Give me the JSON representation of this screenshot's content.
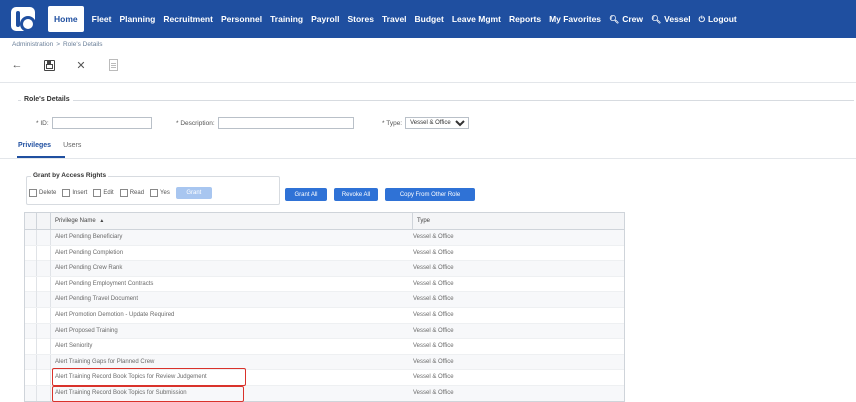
{
  "nav": {
    "items": [
      {
        "label": "Home",
        "active": true
      },
      {
        "label": "Fleet"
      },
      {
        "label": "Planning"
      },
      {
        "label": "Recruitment"
      },
      {
        "label": "Personnel"
      },
      {
        "label": "Training"
      },
      {
        "label": "Payroll"
      },
      {
        "label": "Stores"
      },
      {
        "label": "Travel"
      },
      {
        "label": "Budget"
      },
      {
        "label": "Leave Mgmt"
      },
      {
        "label": "Reports"
      },
      {
        "label": "My Favorites"
      },
      {
        "label": "Crew",
        "icon": "search-icon"
      },
      {
        "label": "Vessel",
        "icon": "search-icon"
      },
      {
        "label": "Logout",
        "icon": "power-icon"
      }
    ]
  },
  "breadcrumb": {
    "root": "Administration",
    "separator": ">",
    "current": "Role's Details"
  },
  "toolbar": {
    "icons": [
      "back-arrow-icon",
      "save-icon",
      "close-icon",
      "document-icon"
    ]
  },
  "details": {
    "title": "Role's Details",
    "id_label": "* ID:",
    "id_value": "",
    "description_label": "* Description:",
    "description_value": "",
    "type_label": "* Type:",
    "type_value": "Vessel & Office"
  },
  "tabs": [
    {
      "label": "Privileges",
      "active": true
    },
    {
      "label": "Users"
    }
  ],
  "grant": {
    "title": "Grant by Access Rights",
    "checks": [
      "Delete",
      "Insert",
      "Edit",
      "Read",
      "Yes"
    ],
    "grant_button": "Grant"
  },
  "actions": {
    "grant_all": "Grant All",
    "revoke_all": "Revoke All",
    "copy": "Copy From Other Role"
  },
  "grid": {
    "columns": [
      "Privilege Name",
      "Type"
    ],
    "sort_indicator": "▲",
    "rows": [
      {
        "name": "Alert Pending Beneficiary",
        "type": "Vessel & Office"
      },
      {
        "name": "Alert Pending Completion",
        "type": "Vessel & Office"
      },
      {
        "name": "Alert Pending Crew Rank",
        "type": "Vessel & Office"
      },
      {
        "name": "Alert Pending Employment Contracts",
        "type": "Vessel & Office"
      },
      {
        "name": "Alert Pending Travel Document",
        "type": "Vessel & Office"
      },
      {
        "name": "Alert Promotion Demotion - Update Required",
        "type": "Vessel & Office"
      },
      {
        "name": "Alert Proposed Training",
        "type": "Vessel & Office"
      },
      {
        "name": "Alert Seniority",
        "type": "Vessel & Office"
      },
      {
        "name": "Alert Training Gaps for Planned Crew",
        "type": "Vessel & Office"
      },
      {
        "name": "Alert Training Record Book Topics for Review Judgement",
        "type": "Vessel & Office"
      },
      {
        "name": "Alert Training Record Book Topics for Submission",
        "type": "Vessel & Office"
      }
    ]
  },
  "colors": {
    "brand": "#1f4fa0",
    "highlight": "#d9322b",
    "button": "#2f72d6"
  }
}
